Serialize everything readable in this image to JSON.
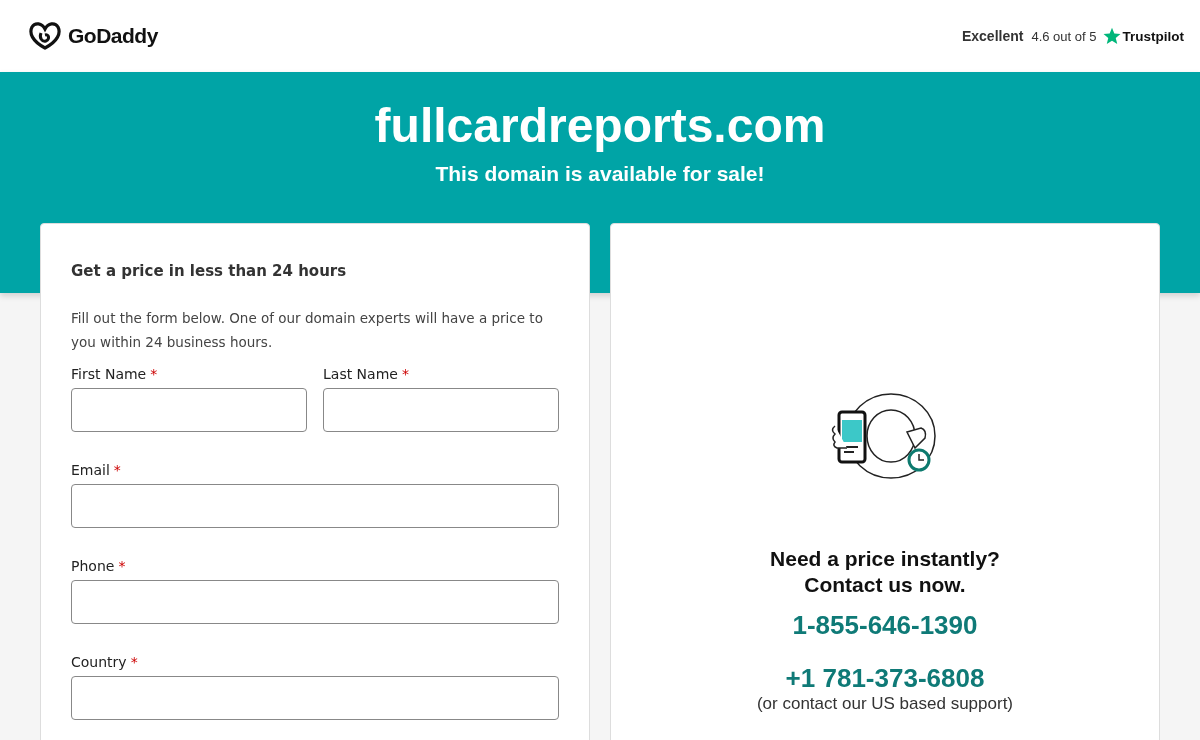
{
  "header": {
    "logo": "GoDaddy",
    "rating": {
      "label": "Excellent",
      "score": "4.6 out of 5",
      "brand": "Trustpilot"
    }
  },
  "hero": {
    "domain": "fullcardreports.com",
    "subtitle": "This domain is available for sale!"
  },
  "form": {
    "title": "Get a price in less than 24 hours",
    "intro": "Fill out the form below. One of our domain experts will have a price to you within 24 business hours.",
    "rows": [
      [
        {
          "label": "First Name",
          "required_mark": "*"
        },
        {
          "label": "Last Name",
          "required_mark": "*"
        }
      ],
      [
        {
          "label": "Email",
          "required_mark": "*"
        }
      ],
      [
        {
          "label": "Phone",
          "required_mark": "*"
        }
      ],
      [
        {
          "label": "Country",
          "required_mark": "*"
        }
      ]
    ]
  },
  "contact": {
    "heading": [
      "Need a price instantly?",
      "Contact us now."
    ],
    "phone": "1-855-646-1390",
    "phone_alt": "+1 781-373-6808",
    "note": "(or contact our US based support)"
  }
}
